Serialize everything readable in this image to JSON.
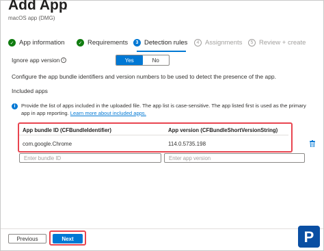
{
  "header": {
    "title": "Add App",
    "more": "…",
    "subtitle": "macOS app (DMG)"
  },
  "steps": [
    {
      "label": "App information",
      "marker": "✓",
      "state": "done"
    },
    {
      "label": "Requirements",
      "marker": "✓",
      "state": "done"
    },
    {
      "label": "Detection rules",
      "marker": "3",
      "state": "active"
    },
    {
      "label": "Assignments",
      "marker": "4",
      "state": "todo"
    },
    {
      "label": "Review + create",
      "marker": "5",
      "state": "todo"
    }
  ],
  "ignore_version": {
    "label": "Ignore app version",
    "info_glyph": "i",
    "yes": "Yes",
    "no": "No",
    "selected": "Yes"
  },
  "description": "Configure the app bundle identifiers and version numbers to be used to detect the presence of the app.",
  "included_apps_label": "Included apps",
  "info": {
    "glyph": "i",
    "text": "Provide the list of apps included in the uploaded file. The app list is case-sensitive. The app listed first is used as the primary app in app reporting.",
    "link": "Learn more about included apps."
  },
  "table": {
    "col_bundle": "App bundle ID (CFBundleIdentifier)",
    "col_version": "App version (CFBundleShortVersionString)",
    "rows": [
      {
        "bundle_id": "com.google.Chrome",
        "version": "114.0.5735.198"
      }
    ]
  },
  "new_entry": {
    "bundle_placeholder": "Enter bundle ID",
    "version_placeholder": "Enter app version"
  },
  "footer": {
    "previous": "Previous",
    "next": "Next"
  },
  "colors": {
    "accent": "#0078d4",
    "done": "#107c10",
    "highlight": "#e8444f"
  },
  "logo": {
    "letter": "P"
  }
}
